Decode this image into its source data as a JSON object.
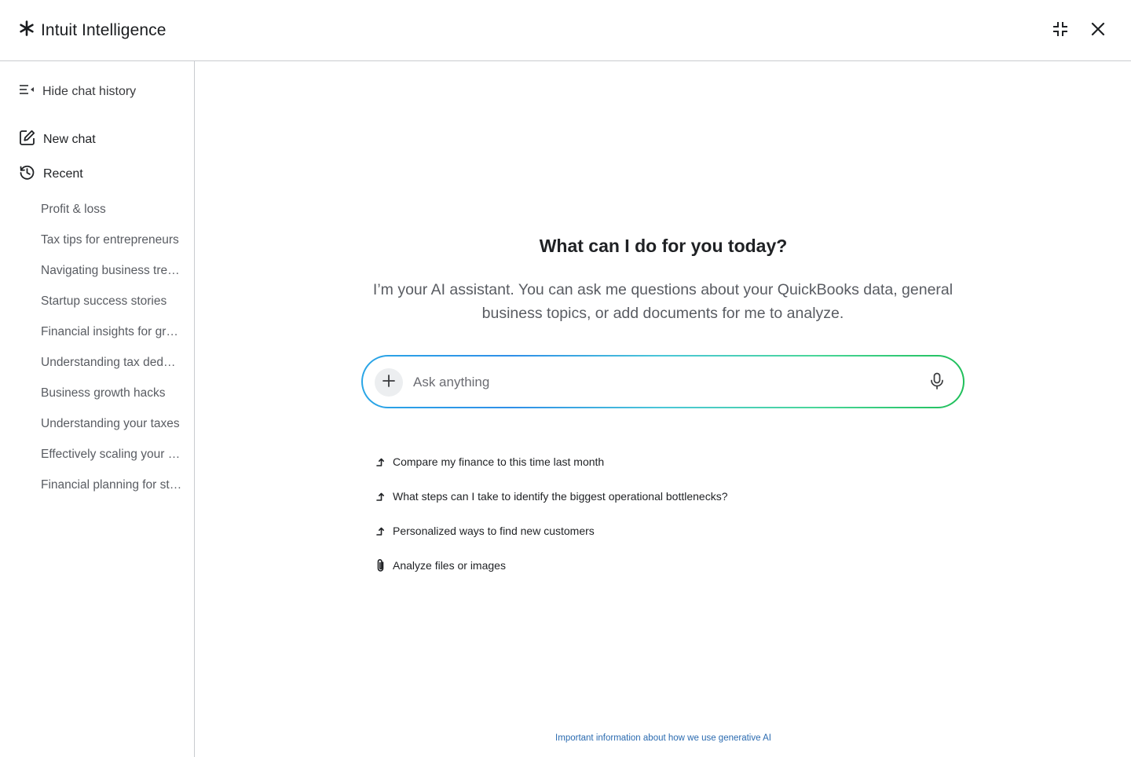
{
  "header": {
    "title": "Intuit Intelligence",
    "logo_icon": "asterisk-icon",
    "minimize_icon": "collapse-icon",
    "close_icon": "close-icon"
  },
  "sidebar": {
    "hide_history_label": "Hide chat history",
    "new_chat_label": "New chat",
    "recent_label": "Recent",
    "recent_items": [
      "Profit & loss",
      "Tax tips for entrepreneurs",
      "Navigating business trends",
      "Startup success stories",
      "Financial insights for growth",
      "Understanding tax deductions",
      "Business growth hacks",
      "Understanding your taxes",
      "Effectively scaling your business",
      "Financial planning for startups"
    ]
  },
  "main": {
    "headline": "What can I do for you today?",
    "intro": "I’m your AI assistant. You can ask me questions about your QuickBooks data, general business topics, or add documents for me to analyze.",
    "input_placeholder": "Ask anything",
    "suggestions": [
      "Compare my finance to this time last month",
      "What steps can I take to identify the biggest operational bottlenecks?",
      "Personalized ways to find new customers",
      "Analyze files or images"
    ],
    "footer_link": "Important information about how we use generative AI"
  },
  "colors": {
    "gradient_start": "#2aa6e6",
    "gradient_end": "#1fbf5a",
    "link": "#2b6bb0",
    "divider": "#c9cbcf"
  }
}
